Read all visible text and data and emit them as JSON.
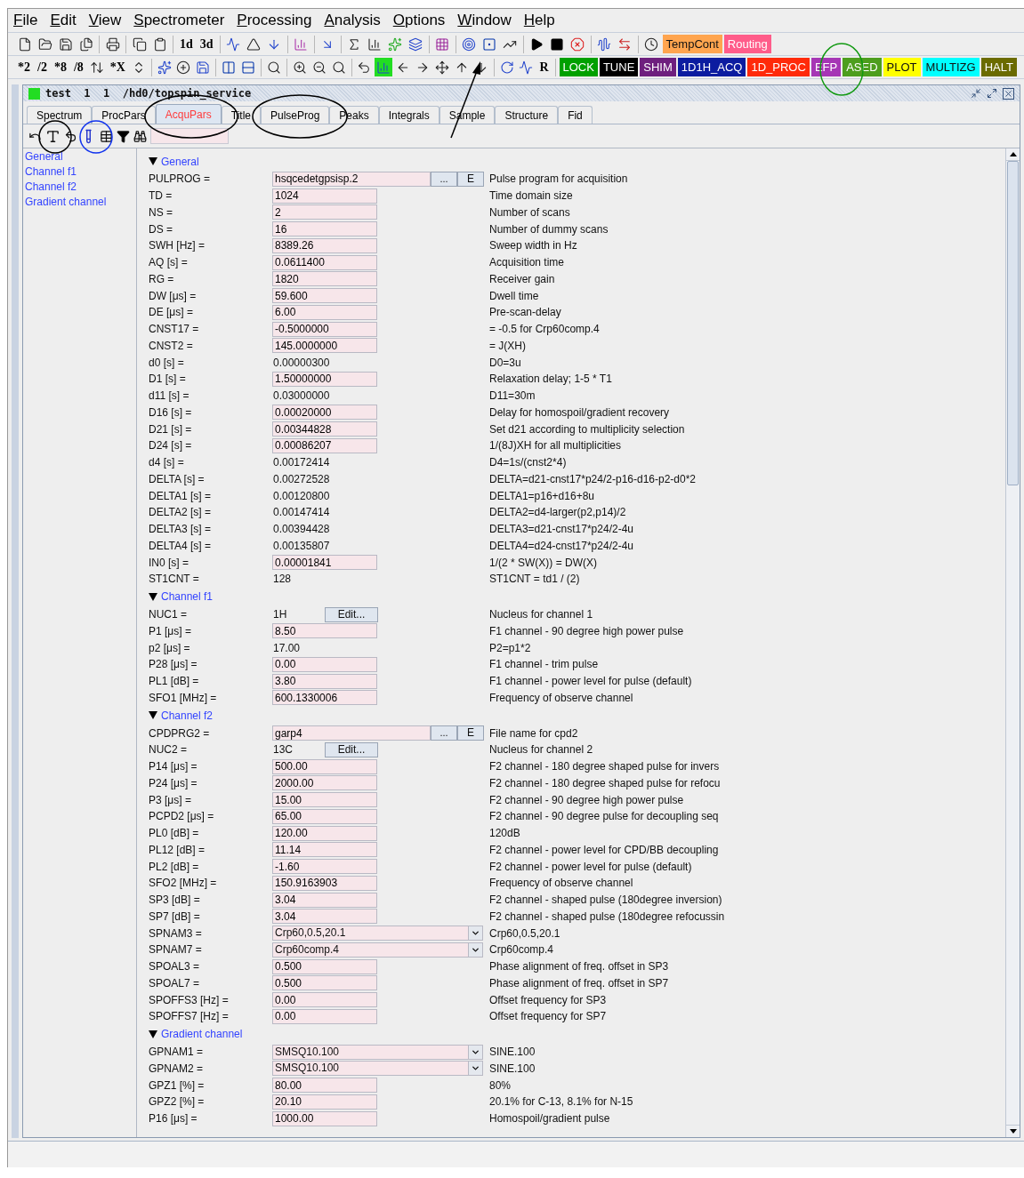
{
  "menu": [
    "File",
    "Edit",
    "View",
    "Spectrometer",
    "Processing",
    "Analysis",
    "Options",
    "Window",
    "Help"
  ],
  "toolbar_1": [
    {
      "kind": "icon"
    },
    {
      "kind": "icon"
    },
    {
      "kind": "icon"
    },
    {
      "kind": "icon"
    },
    {
      "kind": "sep"
    },
    {
      "kind": "icon"
    },
    {
      "kind": "sep"
    },
    {
      "kind": "icon"
    },
    {
      "kind": "icon"
    },
    {
      "kind": "sep"
    },
    {
      "kind": "text",
      "label": "1d"
    },
    {
      "kind": "text",
      "label": "3d"
    },
    {
      "kind": "sep"
    },
    {
      "kind": "icon"
    },
    {
      "kind": "icon"
    },
    {
      "kind": "icon"
    },
    {
      "kind": "sep"
    },
    {
      "kind": "icon"
    },
    {
      "kind": "sep"
    },
    {
      "kind": "icon"
    },
    {
      "kind": "sep"
    },
    {
      "kind": "icon"
    },
    {
      "kind": "icon"
    },
    {
      "kind": "icon"
    },
    {
      "kind": "icon"
    },
    {
      "kind": "sep"
    },
    {
      "kind": "icon"
    },
    {
      "kind": "sep"
    },
    {
      "kind": "icon"
    },
    {
      "kind": "icon"
    },
    {
      "kind": "icon"
    },
    {
      "kind": "sep"
    },
    {
      "kind": "icon"
    },
    {
      "kind": "icon"
    },
    {
      "kind": "icon"
    },
    {
      "kind": "sep"
    },
    {
      "kind": "icon"
    },
    {
      "kind": "icon"
    },
    {
      "kind": "sep"
    },
    {
      "kind": "icon"
    },
    {
      "kind": "tag",
      "label": "TempCont",
      "color": "#ffa54f"
    },
    {
      "kind": "tag",
      "label": "Routing",
      "color": "#ff5c8a"
    }
  ],
  "toolbar_2": [
    {
      "kind": "text",
      "label": "*2"
    },
    {
      "kind": "text",
      "label": "/2"
    },
    {
      "kind": "text",
      "label": "*8"
    },
    {
      "kind": "text",
      "label": "/8"
    },
    {
      "kind": "icon"
    },
    {
      "kind": "text",
      "label": "*X"
    },
    {
      "kind": "icon"
    },
    {
      "kind": "sep"
    },
    {
      "kind": "icon"
    },
    {
      "kind": "icon"
    },
    {
      "kind": "icon"
    },
    {
      "kind": "sep"
    },
    {
      "kind": "icon"
    },
    {
      "kind": "icon"
    },
    {
      "kind": "sep"
    },
    {
      "kind": "icon"
    },
    {
      "kind": "sep"
    },
    {
      "kind": "icon"
    },
    {
      "kind": "icon"
    },
    {
      "kind": "icon"
    },
    {
      "kind": "sep"
    },
    {
      "kind": "icon"
    },
    {
      "kind": "icon"
    },
    {
      "kind": "icon"
    },
    {
      "kind": "icon"
    },
    {
      "kind": "icon"
    },
    {
      "kind": "icon"
    },
    {
      "kind": "icon"
    },
    {
      "kind": "sep"
    },
    {
      "kind": "icon"
    },
    {
      "kind": "icon"
    },
    {
      "kind": "text",
      "label": "R"
    },
    {
      "kind": "sep"
    },
    {
      "kind": "tag",
      "label": "LOCK",
      "color": "#00a000"
    },
    {
      "kind": "tag",
      "label": "TUNE",
      "color": "#000000"
    },
    {
      "kind": "tag",
      "label": "SHIM",
      "color": "#6e1f7e"
    },
    {
      "kind": "tag",
      "label": "1D1H_ACQ",
      "color": "#0c1ca0"
    },
    {
      "kind": "tag",
      "label": "1D_PROC",
      "color": "#ff2a0a"
    },
    {
      "kind": "tag",
      "label": "EFP",
      "color": "#a636b5"
    },
    {
      "kind": "tag",
      "label": "ASED",
      "color": "#4d9e1e"
    },
    {
      "kind": "tag",
      "label": "PLOT",
      "color": "#ffff00"
    },
    {
      "kind": "tag",
      "label": "MULTIZG",
      "color": "#00ffff"
    },
    {
      "kind": "tag",
      "label": "HALT",
      "color": "#6b6b00"
    }
  ],
  "window": {
    "title": "test  1  1  /hd0/topspin_service"
  },
  "tabs": [
    {
      "label": "Spectrum",
      "selected": false
    },
    {
      "label": "ProcPars",
      "selected": false
    },
    {
      "label": "AcquPars",
      "selected": true
    },
    {
      "label": "Title",
      "selected": false
    },
    {
      "label": "PulseProg",
      "selected": false
    },
    {
      "label": "Peaks",
      "selected": false
    },
    {
      "label": "Integrals",
      "selected": false
    },
    {
      "label": "Sample",
      "selected": false
    },
    {
      "label": "Structure",
      "selected": false
    },
    {
      "label": "Fid",
      "selected": false
    }
  ],
  "sidebar": {
    "items": [
      "General",
      "Channel f1",
      "Channel f2",
      "Gradient channel"
    ]
  },
  "sections": [
    {
      "title": "General",
      "expanded": true,
      "rows": [
        {
          "kind": "file",
          "name": "PULPROG =",
          "value": "hsqcedetgpsisp.2",
          "browse": "...",
          "edit": "E",
          "description": "Pulse program for acquisition"
        },
        {
          "kind": "field",
          "name": "TD =",
          "value": "1024",
          "description": "Time domain size"
        },
        {
          "kind": "field",
          "name": "NS =",
          "value": "2",
          "description": "Number of scans"
        },
        {
          "kind": "field",
          "name": "DS =",
          "value": "16",
          "description": "Number of dummy scans"
        },
        {
          "kind": "field",
          "name": "SWH [Hz] =",
          "value": "8389.26",
          "description": "Sweep width in Hz"
        },
        {
          "kind": "field",
          "name": "AQ [s] =",
          "value": "0.0611400",
          "description": "Acquisition time"
        },
        {
          "kind": "field",
          "name": "RG =",
          "value": "1820",
          "description": "Receiver gain"
        },
        {
          "kind": "field",
          "name": "DW [μs] =",
          "value": "59.600",
          "description": "Dwell time"
        },
        {
          "kind": "field",
          "name": "DE [μs] =",
          "value": "6.00",
          "description": "Pre-scan-delay"
        },
        {
          "kind": "field",
          "name": "CNST17 =",
          "value": "-0.5000000",
          "description": "= -0.5 for Crp60comp.4"
        },
        {
          "kind": "field",
          "name": "CNST2 =",
          "value": "145.0000000",
          "description": "= J(XH)"
        },
        {
          "kind": "plain",
          "name": "d0 [s] =",
          "value": "0.00000300",
          "description": "D0=3u"
        },
        {
          "kind": "field",
          "name": "D1 [s] =",
          "value": "1.50000000",
          "description": "Relaxation delay; 1-5 * T1"
        },
        {
          "kind": "plain",
          "name": "d11 [s] =",
          "value": "0.03000000",
          "description": "D11=30m"
        },
        {
          "kind": "field",
          "name": "D16 [s] =",
          "value": "0.00020000",
          "description": "Delay for homospoil/gradient recovery"
        },
        {
          "kind": "field",
          "name": "D21 [s] =",
          "value": "0.00344828",
          "description": "Set d21 according to multiplicity selection"
        },
        {
          "kind": "field",
          "name": "D24 [s] =",
          "value": "0.00086207",
          "description": "1/(8J)XH for all multiplicities"
        },
        {
          "kind": "plain",
          "name": "d4 [s] =",
          "value": "0.00172414",
          "description": "D4=1s/(cnst2*4)"
        },
        {
          "kind": "plain",
          "name": "DELTA [s] =",
          "value": "0.00272528",
          "description": "DELTA=d21-cnst17*p24/2-p16-d16-p2-d0*2"
        },
        {
          "kind": "plain",
          "name": "DELTA1 [s] =",
          "value": "0.00120800",
          "description": "DELTA1=p16+d16+8u"
        },
        {
          "kind": "plain",
          "name": "DELTA2 [s] =",
          "value": "0.00147414",
          "description": "DELTA2=d4-larger(p2,p14)/2"
        },
        {
          "kind": "plain",
          "name": "DELTA3 [s] =",
          "value": "0.00394428",
          "description": "DELTA3=d21-cnst17*p24/2-4u"
        },
        {
          "kind": "plain",
          "name": "DELTA4 [s] =",
          "value": "0.00135807",
          "description": "DELTA4=d24-cnst17*p24/2-4u"
        },
        {
          "kind": "field",
          "name": "IN0 [s] =",
          "value": "0.00001841",
          "description": "1/(2 * SW(X)) = DW(X)"
        },
        {
          "kind": "plain",
          "name": "ST1CNT =",
          "value": "128",
          "description": "ST1CNT = td1 / (2)"
        }
      ]
    },
    {
      "title": "Channel f1",
      "expanded": true,
      "rows": [
        {
          "kind": "nucleus",
          "name": "NUC1 =",
          "value": "1H",
          "edit": "Edit...",
          "description": "Nucleus for channel 1"
        },
        {
          "kind": "field",
          "name": "P1 [μs] =",
          "value": "8.50",
          "description": "F1 channel -  90 degree high power pulse"
        },
        {
          "kind": "plain",
          "name": "p2 [μs] =",
          "value": "17.00",
          "description": "P2=p1*2"
        },
        {
          "kind": "field",
          "name": "P28 [μs] =",
          "value": "0.00",
          "description": "F1 channel - trim pulse"
        },
        {
          "kind": "field",
          "name": "PL1 [dB] =",
          "value": "3.80",
          "description": "F1 channel - power level for pulse (default)"
        },
        {
          "kind": "field",
          "name": "SFO1 [MHz] =",
          "value": "600.1330006",
          "description": "Frequency of observe channel"
        }
      ]
    },
    {
      "title": "Channel f2",
      "expanded": true,
      "rows": [
        {
          "kind": "file",
          "name": "CPDPRG2 =",
          "value": "garp4",
          "browse": "...",
          "edit": "E",
          "description": "File name for cpd2"
        },
        {
          "kind": "nucleus",
          "name": "NUC2 =",
          "value": "13C",
          "edit": "Edit...",
          "description": "Nucleus for channel 2"
        },
        {
          "kind": "field",
          "name": "P14 [μs] =",
          "value": "500.00",
          "description": "F2 channel - 180 degree shaped pulse for invers"
        },
        {
          "kind": "field",
          "name": "P24 [μs] =",
          "value": "2000.00",
          "description": "F2 channel - 180 degree shaped pulse for refocu"
        },
        {
          "kind": "field",
          "name": "P3 [μs] =",
          "value": "15.00",
          "description": "F2 channel -  90 degree high power pulse"
        },
        {
          "kind": "field",
          "name": "PCPD2 [μs] =",
          "value": "65.00",
          "description": "F2 channel - 90 degree pulse for decoupling seq"
        },
        {
          "kind": "field",
          "name": "PL0 [dB] =",
          "value": "120.00",
          "description": "120dB"
        },
        {
          "kind": "field",
          "name": "PL12 [dB] =",
          "value": "11.14",
          "description": "F2 channel - power level for CPD/BB decoupling"
        },
        {
          "kind": "field",
          "name": "PL2 [dB] =",
          "value": "-1.60",
          "description": "F2 channel - power level for pulse (default)"
        },
        {
          "kind": "field",
          "name": "SFO2 [MHz] =",
          "value": "150.9163903",
          "description": "Frequency of observe channel"
        },
        {
          "kind": "field",
          "name": "SP3 [dB] =",
          "value": "3.04",
          "description": "F2 channel - shaped pulse (180degree inversion)"
        },
        {
          "kind": "field",
          "name": "SP7 [dB] =",
          "value": "3.04",
          "description": "F2 channel - shaped pulse (180degree refocussin"
        },
        {
          "kind": "dropdown",
          "name": "SPNAM3 =",
          "value": "Crp60,0.5,20.1",
          "description": "Crp60,0.5,20.1"
        },
        {
          "kind": "dropdown",
          "name": "SPNAM7 =",
          "value": "Crp60comp.4",
          "description": "Crp60comp.4"
        },
        {
          "kind": "field",
          "name": "SPOAL3 =",
          "value": "0.500",
          "description": "Phase alignment of freq. offset in SP3"
        },
        {
          "kind": "field",
          "name": "SPOAL7 =",
          "value": "0.500",
          "description": "Phase alignment of freq. offset in SP7"
        },
        {
          "kind": "field",
          "name": "SPOFFS3 [Hz] =",
          "value": "0.00",
          "description": "Offset frequency for SP3"
        },
        {
          "kind": "field",
          "name": "SPOFFS7 [Hz] =",
          "value": "0.00",
          "description": "Offset frequency for SP7"
        }
      ]
    },
    {
      "title": "Gradient channel",
      "expanded": true,
      "rows": [
        {
          "kind": "dropdown",
          "name": "GPNAM1 =",
          "value": "SMSQ10.100",
          "description": "SINE.100"
        },
        {
          "kind": "dropdown",
          "name": "GPNAM2 =",
          "value": "SMSQ10.100",
          "description": "SINE.100"
        },
        {
          "kind": "field",
          "name": "GPZ1 [%] =",
          "value": "80.00",
          "description": "80%"
        },
        {
          "kind": "field",
          "name": "GPZ2 [%] =",
          "value": "20.10",
          "description": "20.1% for C-13, 8.1% for N-15"
        },
        {
          "kind": "field",
          "name": "P16 [μs] =",
          "value": "1000.00",
          "description": "Homospoil/gradient pulse"
        }
      ]
    }
  ]
}
